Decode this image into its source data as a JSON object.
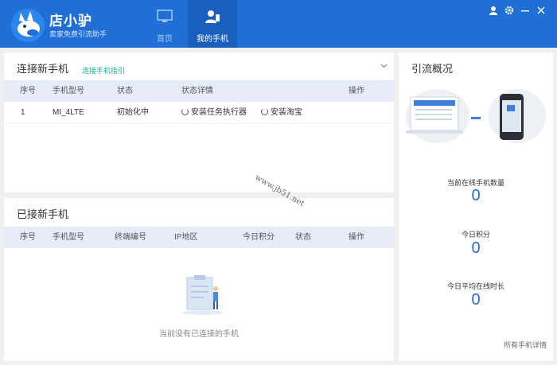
{
  "app": {
    "name": "店小驴",
    "subtitle": "卖家免费引流助手"
  },
  "nav": {
    "tabs": [
      {
        "label": "首页"
      },
      {
        "label": "我的手机"
      }
    ]
  },
  "connect_panel": {
    "title": "连接新手机",
    "guide_link": "连接手机指引",
    "columns": [
      "序号",
      "手机型号",
      "状态",
      "状态详情",
      "操作"
    ],
    "rows": [
      {
        "index": "1",
        "model": "MI_4LTE",
        "status": "初始化中",
        "detail1": "安装任务执行器",
        "detail2": "安装淘宝"
      }
    ]
  },
  "connected_panel": {
    "title": "已接新手机",
    "columns": [
      "序号",
      "手机型号",
      "终端编号",
      "IP地区",
      "今日积分",
      "状态",
      "操作"
    ],
    "empty_text": "当前没有已连接的手机"
  },
  "overview": {
    "title": "引流概况",
    "stats": [
      {
        "label": "当前在线手机数量",
        "value": "0"
      },
      {
        "label": "今日积分",
        "value": "0"
      },
      {
        "label": "今日平均在线时长",
        "value": "0"
      }
    ],
    "all_link": "所有手机详情"
  },
  "watermark": "www.jb51.net",
  "colors": {
    "header": "#1f6fd6",
    "accent": "#1f6fd6",
    "guide": "#19b394"
  },
  "icons": [
    "donkey-logo-icon",
    "monitor-icon",
    "user-phone-icon",
    "skin-icon",
    "gear-icon",
    "minimize-icon",
    "close-icon",
    "chevron-down-icon",
    "spinner-icon",
    "clipboard-person-icon",
    "laptop-phone-icon"
  ]
}
